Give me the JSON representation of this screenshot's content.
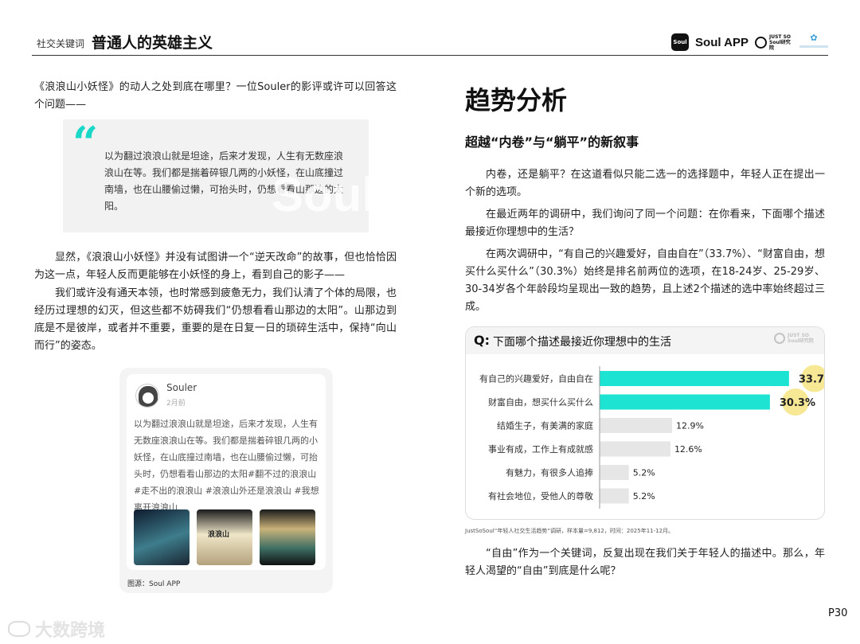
{
  "header": {
    "keyword_label": "社交关键词",
    "keyword_title": "普通人的英雄主义",
    "soul_icon_text": "Soul",
    "soul_app": "Soul APP",
    "jss_line1": "JUST SO",
    "jss_line2": "Soul研究院"
  },
  "left": {
    "intro": "《浪浪山小妖怪》的动人之处到底在哪里？一位Souler的影评或许可以回答这个问题——",
    "quote_mark": "“",
    "quote": "以为翻过浪浪山就是坦途，后来才发现，人生有无数座浪浪山在等。我们都是揣着碎银几两的小妖怪，在山底撞过南墙，也在山腰偷过懒，可抬头时，仍想看看山那边的太阳。",
    "quote_watermark": "Soul",
    "para1": "显然，《浪浪山小妖怪》并没有试图讲一个“逆天改命”的故事，但也恰恰因为这一点，年轻人反而更能够在小妖怪的身上，看到自己的影子——",
    "para2": "我们或许没有通天本领，也时常感到疲惫无力，我们认清了个体的局限，也经历过理想的幻灭，但这些都不妨碍我们“仍想看看山那边的太阳”。山那边到底是不是彼岸，或者并不重要，重要的是在日复一日的琐碎生活中，保持“向山而行”的姿态。",
    "post": {
      "user": "Souler",
      "time": "2月前",
      "text": "以为翻过浪浪山就是坦途，后来才发现，人生有无数座浪浪山在等。我们都是揣着碎银几两的小妖怪，在山底撞过南墙，也在山腰偷过懒，可抬头时，仍想看看山那边的太阳#翻不过的浪浪山 #走不出的浪浪山 #浪浪山外还是浪浪山 #我想离开浪浪山",
      "thumb2_text": "浪浪山",
      "source": "图源：Soul APP"
    }
  },
  "right": {
    "section_title": "趋势分析",
    "subtitle": "超越“内卷”与“躺平”的新叙事",
    "para1": "内卷，还是躺平？在这道看似只能二选一的选择题中，年轻人正在提出一个新的选项。",
    "para2": "在最近两年的调研中，我们询问了同一个问题：在你看来，下面哪个描述最接近你理想中的生活？",
    "para3": "在两次调研中，“有自己的兴趣爱好，自由自在”（33.7%）、“财富自由，想买什么买什么”（30.3%）始终是排名前两位的选项，在18-24岁、25-29岁、30-34岁各个年龄段均呈现出一致的趋势，且上述2个描述的选中率始终超过三成。",
    "chart_q_prefix": "Q:",
    "chart_question": "下面哪个描述最接近你理想中的生活",
    "chart_logo_line1": "JUST SO",
    "chart_logo_line2": "Soul研究院",
    "footnote": "JustSoSoul“年轻人社交生活趋势”调研，样本量=9,812，时间：2025年11-12月。",
    "para4": "“自由”作为一个关键词，反复出现在我们关于年轻人的描述中。那么，年轻人渴望的“自由”到底是什么呢？"
  },
  "chart_data": {
    "type": "bar",
    "orientation": "horizontal",
    "title": "下面哪个描述最接近你理想中的生活",
    "categories": [
      "有自己的兴趣爱好，自由自在",
      "财富自由，想买什么买什么",
      "结婚生子，有美满的家庭",
      "事业有成，工作上有成就感",
      "有魅力，有很多人追捧",
      "有社会地位，受他人的尊敬"
    ],
    "values": [
      33.7,
      30.3,
      12.9,
      12.6,
      5.2,
      5.2
    ],
    "labels": [
      "33.7%",
      "30.3%",
      "12.9%",
      "12.6%",
      "5.2%",
      "5.2%"
    ],
    "highlight_top": 2,
    "xlim": [
      0,
      34
    ],
    "colors": {
      "highlight": "#1de3d2",
      "normal": "#e6e6e6",
      "burst": "#f5e27a"
    },
    "grid": false,
    "legend": "none"
  },
  "page": {
    "number": "P30",
    "watermark": "大数跨境"
  }
}
